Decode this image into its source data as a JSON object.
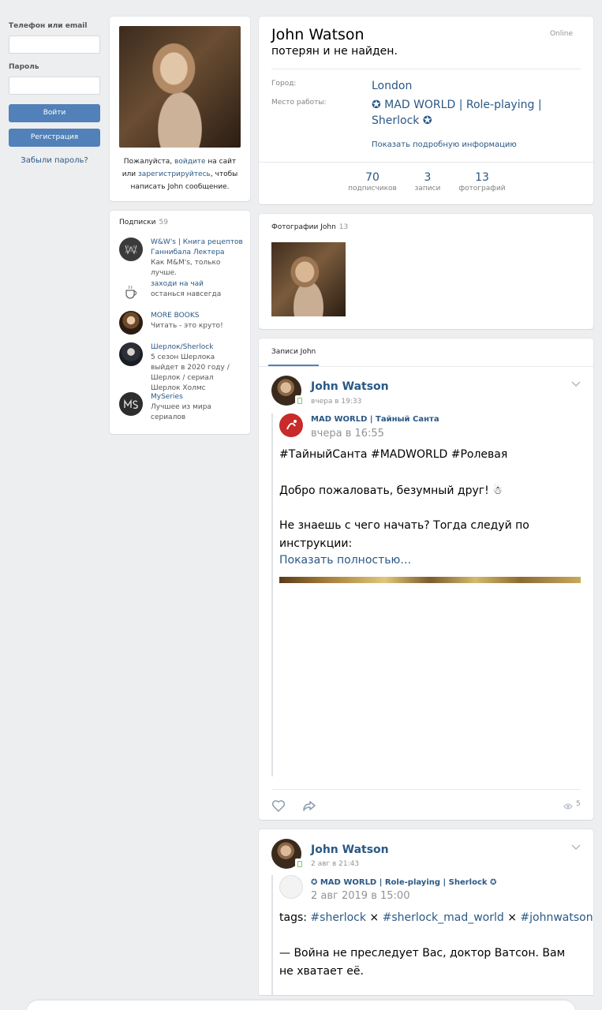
{
  "login": {
    "phone_label": "Телефон или email",
    "phone_value": "",
    "password_label": "Пароль",
    "password_value": "",
    "login_button": "Войти",
    "register_button": "Регистрация",
    "forgot_link": "Забыли пароль?"
  },
  "avatar_card": {
    "note_prefix": "Пожалуйста, ",
    "note_login": "войдите",
    "note_mid": " на сайт или ",
    "note_register": "зарегистрируйтесь",
    "note_suffix": ", чтобы написать John сообщение."
  },
  "subscriptions": {
    "title": "Подписки",
    "count": "59",
    "items": [
      {
        "name": "W&W's | Книга рецептов Ганнибала Лектера",
        "desc": "Как M&M's, только лучше.",
        "icon": "ww-logo-icon"
      },
      {
        "name": "заходи на чай",
        "desc": "останься навсегда",
        "icon": "teacup-icon"
      },
      {
        "name": "MORE BOOKS",
        "desc": "Читать - это круто!",
        "icon": "books-avatar"
      },
      {
        "name": "Шерлок/Sherlock",
        "desc": "5 сезон Шерлока выйдет в 2020 году / Шерлок / сериал Шерлок Холмс",
        "icon": "sherlock-avatar"
      },
      {
        "name": "MySeries",
        "desc": "Лучшее из мира сериалов",
        "icon": "ms-logo-icon"
      }
    ]
  },
  "profile": {
    "name": "John Watson",
    "online": "Online",
    "status": "потерян и не найден.",
    "city_label": "Город:",
    "city_value": "London",
    "work_label": "Место работы:",
    "work_value": "✪ MAD WORLD | Role-playing | Sherlock ✪",
    "more_info": "Показать подробную информацию",
    "counters": [
      {
        "num": "70",
        "label": "подписчиков"
      },
      {
        "num": "3",
        "label": "записи"
      },
      {
        "num": "13",
        "label": "фотографий"
      }
    ]
  },
  "photos": {
    "title": "Фотографии John",
    "count": "13"
  },
  "wall": {
    "tab": "Записи John",
    "posts": [
      {
        "author": "John Watson",
        "time": "вчера в 19:33",
        "repost_group": "MAD WORLD",
        "repost_sub": " | Тайный Санта",
        "repost_time": "вчера в 16:55",
        "hashtags": "#ТайныйСанта #MADWORLD #Ролевая",
        "line1": "Добро пожаловать, безумный друг! ☃",
        "line2": "Не знаешь с чего начать? Тогда следуй по инструкции:",
        "show_more": "Показать полностью…",
        "views": "5"
      },
      {
        "author": "John Watson",
        "time": "2 авг в 21:43",
        "repost_group": "✪ MAD WORLD | Role-playing | Sherlock ✪",
        "repost_time": "2 авг 2019 в 15:00",
        "tags_prefix": "tags: ",
        "tag1": "#sherlock",
        "sep": " × ",
        "tag2": "#sherlock_mad_world",
        "tag3": "#johnwatson",
        "quote": "— Война не преследует Вас, доктор Ватсон. Вам не хватает её."
      }
    ]
  },
  "colors": {
    "accent": "#5181b8",
    "link": "#2a5885",
    "background": "#edeef0"
  }
}
